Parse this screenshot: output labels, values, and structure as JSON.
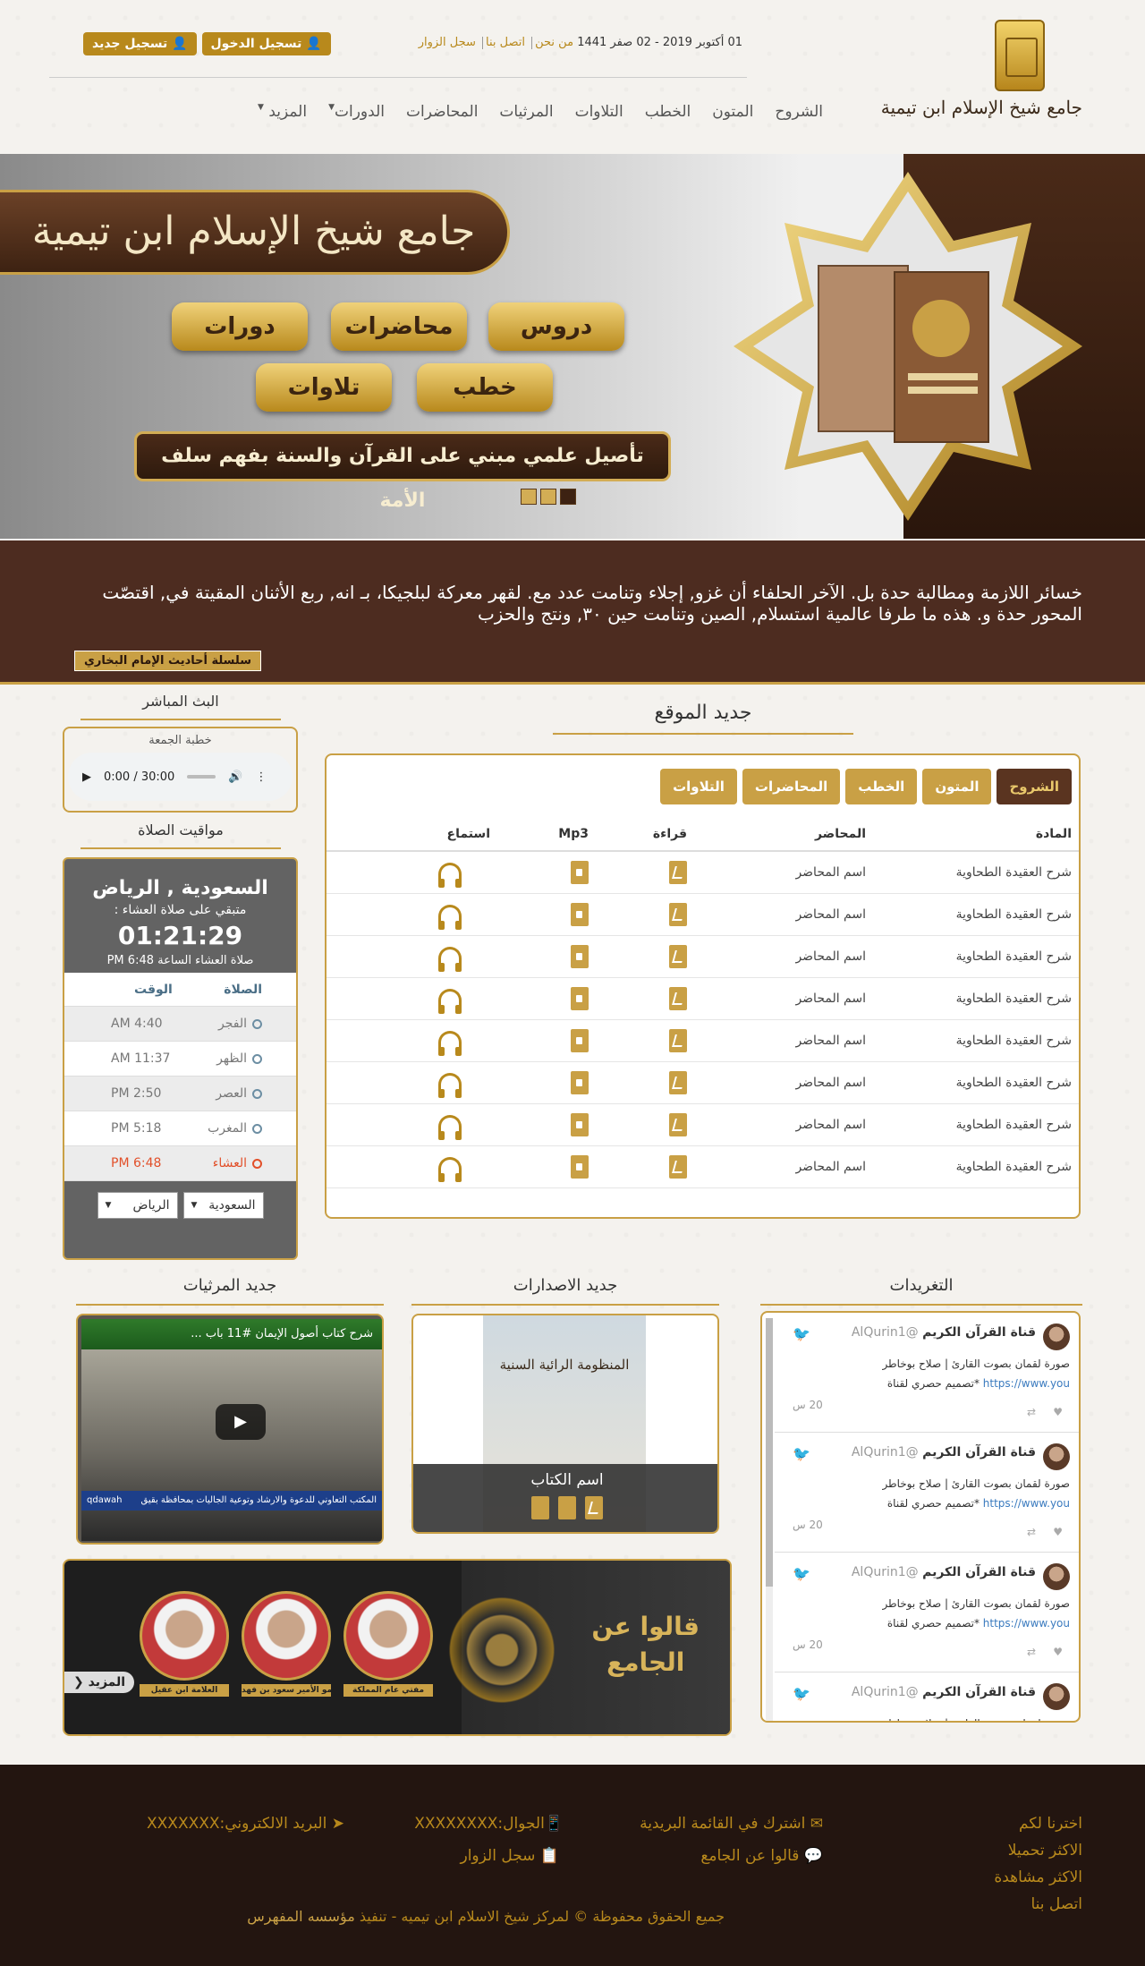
{
  "header": {
    "logo_text": "جامع شيخ الإسلام ابن تيمية",
    "date": "01 أكتوبر 2019 - 02 صفر 1441",
    "links": [
      "من نحن",
      "اتصل بنا",
      "سجل الزوار"
    ],
    "login": "تسجيل الدخول",
    "register": "تسجيل جديد",
    "nav": [
      "الشروح",
      "المتون",
      "الخطب",
      "التلاوات",
      "المرثيات",
      "المحاضرات",
      "الدورات",
      "المزيد"
    ]
  },
  "hero": {
    "title": "جامع شيخ الإسلام ابن تيمية",
    "buttons": [
      "دروس",
      "محاضرات",
      "دورات",
      "خطب",
      "تلاوات"
    ],
    "tagline": "تأصيل علمي مبني على القرآن والسنة بفهم سلف الأمة"
  },
  "band": {
    "text": "خسائر اللازمة ومطالبة حدة بل. الآخر الحلفاء أن غزو, إجلاء وتنامت عدد مع. لقهر معركة لبلجيكا، بـ انه, ربع الأثنان المقيتة في, اقتصّت المحور حدة و. هذه ما طرفا عالمية استسلام, الصين وتنامت حين ٣٠, ونتج والحزب",
    "tag": "سلسلة أحاديث الإمام البخاري"
  },
  "latest": {
    "title": "جديد الموقع",
    "tabs": [
      "الشروح",
      "المتون",
      "الخطب",
      "المحاضرات",
      "التلاوات"
    ],
    "columns": [
      "المادة",
      "المحاضر",
      "قراءة",
      "Mp3",
      "استماع"
    ],
    "rows": [
      {
        "subject": "شرح العقيدة الطحاوية",
        "lecturer": "اسم المحاضر"
      },
      {
        "subject": "شرح العقيدة الطحاوية",
        "lecturer": "اسم المحاضر"
      },
      {
        "subject": "شرح العقيدة الطحاوية",
        "lecturer": "اسم المحاضر"
      },
      {
        "subject": "شرح العقيدة الطحاوية",
        "lecturer": "اسم المحاضر"
      },
      {
        "subject": "شرح العقيدة الطحاوية",
        "lecturer": "اسم المحاضر"
      },
      {
        "subject": "شرح العقيدة الطحاوية",
        "lecturer": "اسم المحاضر"
      },
      {
        "subject": "شرح العقيدة الطحاوية",
        "lecturer": "اسم المحاضر"
      },
      {
        "subject": "شرح العقيدة الطحاوية",
        "lecturer": "اسم المحاضر"
      }
    ]
  },
  "live": {
    "title": "البث المباشر",
    "label": "خطبة الجمعة",
    "time": "0:00 / 30:00"
  },
  "prayer": {
    "title": "مواقيت الصلاة",
    "city": "السعودية , الرياض",
    "remaining": "متبقي على صلاة العشاء :",
    "countdown": "01:21:29",
    "next": "صلاة العشاء الساعة 6:48 PM",
    "col_prayer": "الصلاة",
    "col_time": "الوقت",
    "rows": [
      {
        "name": "الفجر",
        "time": "AM 4:40"
      },
      {
        "name": "الظهر",
        "time": "AM 11:37"
      },
      {
        "name": "العصر",
        "time": "PM 2:50"
      },
      {
        "name": "المغرب",
        "time": "PM 5:18"
      },
      {
        "name": "العشاء",
        "time": "PM 6:48"
      }
    ],
    "country": "السعودية",
    "city_select": "الرياض"
  },
  "tweets": {
    "title": "التغريدات",
    "items": [
      {
        "name": "قناة القرآن الكريم",
        "handle": "@AlQurin1",
        "line1": "صورة لقمان بصوت القارئ | صلاح بوخاطر",
        "line2": "*تصميم حصري لقناة",
        "link": "https://www.you",
        "time": "20 س"
      },
      {
        "name": "قناة القرآن الكريم",
        "handle": "@AlQurin1",
        "line1": "صورة لقمان بصوت القارئ | صلاح بوخاطر",
        "line2": "*تصميم حصري لقناة",
        "link": "https://www.you",
        "time": "20 س"
      },
      {
        "name": "قناة القرآن الكريم",
        "handle": "@AlQurin1",
        "line1": "صورة لقمان بصوت القارئ | صلاح بوخاطر",
        "line2": "*تصميم حصري لقناة",
        "link": "https://www.you",
        "time": "20 س"
      },
      {
        "name": "قناة القرآن الكريم",
        "handle": "@AlQurin1",
        "line1": "صورة لقمان بصوت القارئ | صلاح بوخاطر",
        "line2": "",
        "link": "",
        "time": ""
      }
    ]
  },
  "releases": {
    "title": "جديد الاصدارات",
    "book_title": "اسم الكتاب",
    "cover_text": "المنظومة الرائية السنية"
  },
  "elegies": {
    "title": "جديد المرثيات",
    "video_title": "شرح كتاب أصول الإيمان #11 باب ...",
    "brand": "qdawah",
    "caption": "المكتب التعاوني للدعوة والارشاد وتوعية الجاليات بمحافظة بقيق"
  },
  "testimonials": {
    "title_line1": "قالوا عن",
    "title_line2": "الجامع",
    "people": [
      "مفتي عام المملكة",
      "سمو الأمير سعود بن فهد",
      "العلامة ابن عقيل"
    ],
    "more": "المزيد"
  },
  "footer": {
    "col1": [
      "اخترنا لكم",
      "الاكثر تحميلا",
      "الاكثر مشاهدة",
      "اتصل بنا"
    ],
    "subscribe": "اشترك في القائمة البريدية",
    "said": "قالوا عن الجامع",
    "mobile": "الجوال:XXXXXXXX",
    "guestbook": "سجل الزوار",
    "email": "البريد الالكتروني:XXXXXXX",
    "copyright": "جميع الحقوق محفوظة © لمركز شيخ الاسلام ابن تيميه - تنفيذ",
    "copyright_brand": "مؤسسه المفهرس"
  },
  "colors": {
    "gold": "#c9a045",
    "brown": "#4d2c20",
    "dark": "#231510"
  }
}
